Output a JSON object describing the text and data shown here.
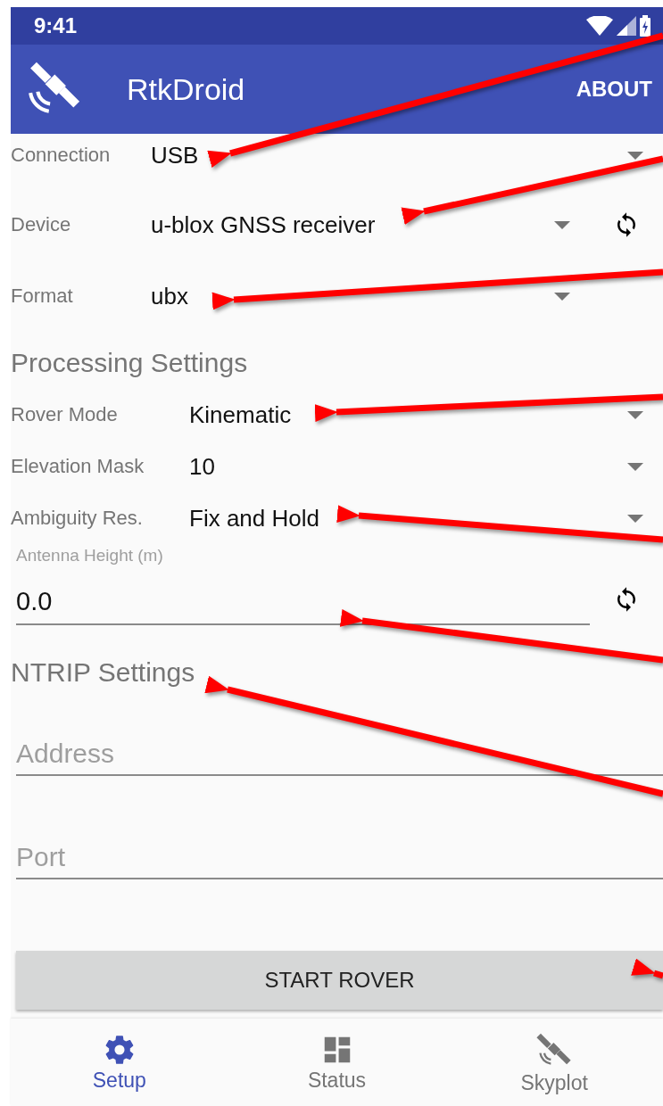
{
  "status_bar": {
    "time": "9:41"
  },
  "app_bar": {
    "title": "RtkDroid",
    "action": "ABOUT"
  },
  "input_settings": [
    {
      "label": "Connection",
      "value": "USB",
      "refresh": false
    },
    {
      "label": "Device",
      "value": "u-blox GNSS receiver",
      "refresh": true
    },
    {
      "label": "Format",
      "value": "ubx",
      "refresh": false
    }
  ],
  "processing": {
    "heading": "Processing Settings",
    "rows": [
      {
        "label": "Rover Mode",
        "value": "Kinematic"
      },
      {
        "label": "Elevation Mask",
        "value": "10"
      },
      {
        "label": "Ambiguity Res.",
        "value": "Fix and Hold"
      }
    ]
  },
  "antenna_height": {
    "label": "Antenna Height (m)",
    "value": "0.0",
    "refresh": true
  },
  "ntrip": {
    "heading": "NTRIP Settings",
    "fields": [
      {
        "placeholder": "Address"
      },
      {
        "placeholder": "Port"
      }
    ]
  },
  "start_button": "START ROVER",
  "bottom_nav": [
    {
      "label": "Setup",
      "selected": true
    },
    {
      "label": "Status",
      "selected": false
    },
    {
      "label": "Skyplot",
      "selected": false
    }
  ]
}
